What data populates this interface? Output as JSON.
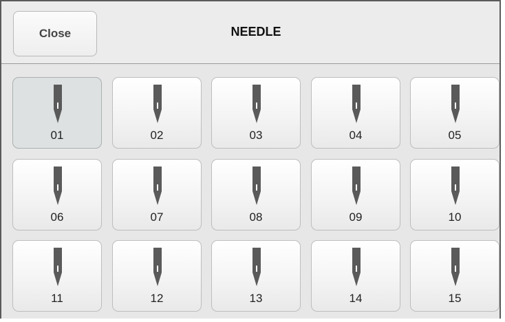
{
  "header": {
    "close_label": "Close",
    "title": "NEEDLE"
  },
  "needles": [
    {
      "label": "01",
      "selected": true
    },
    {
      "label": "02",
      "selected": false
    },
    {
      "label": "03",
      "selected": false
    },
    {
      "label": "04",
      "selected": false
    },
    {
      "label": "05",
      "selected": false
    },
    {
      "label": "06",
      "selected": false
    },
    {
      "label": "07",
      "selected": false
    },
    {
      "label": "08",
      "selected": false
    },
    {
      "label": "09",
      "selected": false
    },
    {
      "label": "10",
      "selected": false
    },
    {
      "label": "11",
      "selected": false
    },
    {
      "label": "12",
      "selected": false
    },
    {
      "label": "13",
      "selected": false
    },
    {
      "label": "14",
      "selected": false
    },
    {
      "label": "15",
      "selected": false
    }
  ],
  "icons": {
    "needle": "needle-icon"
  },
  "colors": {
    "background": "#e7e7e7",
    "button": "#f4f4f4",
    "selected_button": "#dde1e1",
    "needle_icon": "#5a5a5a"
  }
}
